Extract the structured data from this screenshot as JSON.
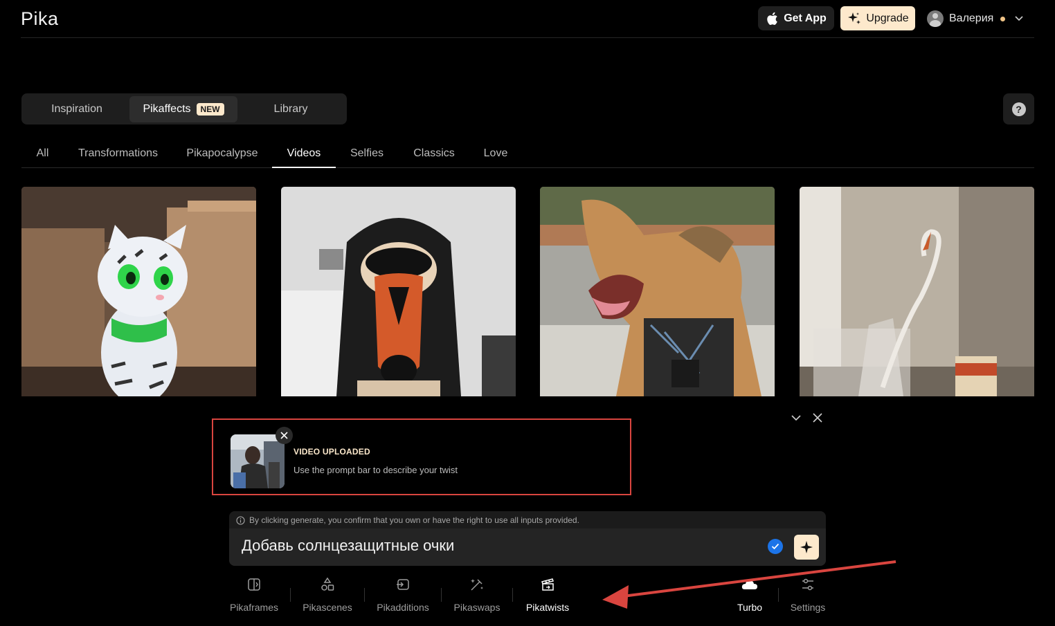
{
  "header": {
    "logo": "Pika",
    "get_app_label": "Get App",
    "upgrade_label": "Upgrade",
    "user_name": "Валерия"
  },
  "main_tabs": [
    {
      "label": "Inspiration",
      "active": false
    },
    {
      "label": "Pikaffects",
      "active": true,
      "badge": "NEW"
    },
    {
      "label": "Library",
      "active": false
    }
  ],
  "help_label": "?",
  "category_tabs": [
    {
      "label": "All",
      "active": false
    },
    {
      "label": "Transformations",
      "active": false
    },
    {
      "label": "Pikapocalypse",
      "active": false
    },
    {
      "label": "Videos",
      "active": true
    },
    {
      "label": "Selfies",
      "active": false
    },
    {
      "label": "Classics",
      "active": false
    },
    {
      "label": "Love",
      "active": false
    }
  ],
  "upload": {
    "title": "VIDEO UPLOADED",
    "subtitle": "Use the prompt bar to describe your twist"
  },
  "prompt": {
    "notice": "By clicking generate, you confirm that you own or have the right to use all inputs provided.",
    "value": "Добавь солнцезащитные очки"
  },
  "toolbar": [
    {
      "label": "Pikaframes",
      "icon": "frames-icon",
      "active": false
    },
    {
      "label": "Pikascenes",
      "icon": "shapes-icon",
      "active": false
    },
    {
      "label": "Pikadditions",
      "icon": "add-frame-icon",
      "active": false
    },
    {
      "label": "Pikaswaps",
      "icon": "wand-icon",
      "active": false
    },
    {
      "label": "Pikatwists",
      "icon": "clapper-icon",
      "active": true
    },
    {
      "label": "Turbo",
      "icon": "cloud-icon",
      "active": false
    },
    {
      "label": "Settings",
      "icon": "sliders-icon",
      "active": false
    }
  ],
  "colors": {
    "accent": "#fde9cc",
    "highlight_box": "#d9453f",
    "check_blue": "#1c74e8"
  }
}
